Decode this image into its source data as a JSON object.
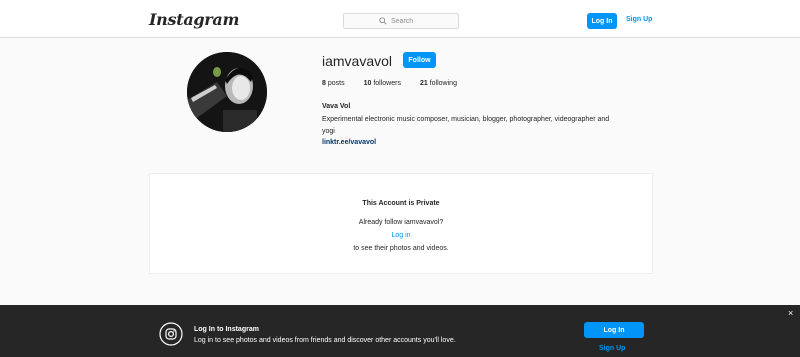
{
  "header": {
    "logo": "Instagram",
    "search_placeholder": "Search",
    "login_label": "Log In",
    "signup_label": "Sign Up"
  },
  "profile": {
    "username": "iamvavavol",
    "follow_label": "Follow",
    "posts_count": "8",
    "posts_label": "posts",
    "followers_count": "10",
    "followers_label": "followers",
    "following_count": "21",
    "following_label": "following",
    "full_name": "Vava Vol",
    "bio": "Experimental electronic music composer, musician, blogger, photographer, videographer and yogi",
    "link": "linktr.ee/vavavol"
  },
  "private": {
    "title": "This Account is Private",
    "question": "Already follow iamvavavol?",
    "login_link": "Log in",
    "see_text": "to see their photos and videos."
  },
  "banner": {
    "title": "Log In to Instagram",
    "text": "Log in to see photos and videos from friends and discover other accounts you'll love.",
    "login_label": "Log In",
    "signup_label": "Sign Up",
    "close_glyph": "×"
  },
  "colors": {
    "accent": "#0095f6",
    "link_dark": "#00376b",
    "banner_bg": "#262626",
    "page_bg": "#fafafa",
    "border": "#dbdbdb"
  }
}
